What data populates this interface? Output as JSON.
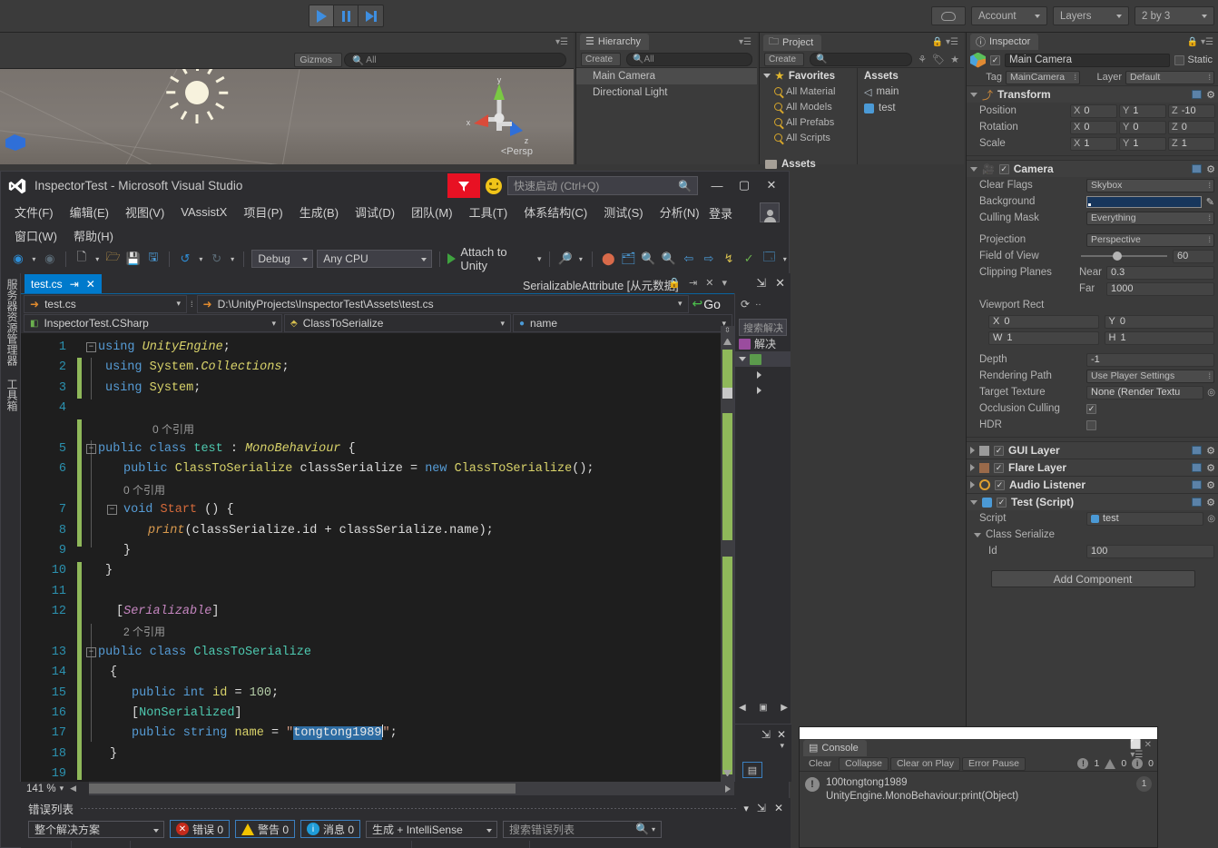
{
  "unity": {
    "toolbar": {
      "play": "play-icon",
      "pause": "pause-icon",
      "step": "step-icon",
      "cloud": "cloud-icon",
      "account": "Account",
      "layers": "Layers",
      "layout": "2 by 3"
    },
    "scene": {
      "gizmos": "Gizmos",
      "search_placeholder": "All",
      "persp": "Persp",
      "axis_x": "x",
      "axis_y": "y",
      "axis_z": "z"
    },
    "hierarchy": {
      "tab": "Hierarchy",
      "create": "Create",
      "search_placeholder": "All",
      "items": [
        {
          "label": "Main Camera",
          "selected": true
        },
        {
          "label": "Directional Light",
          "selected": false
        }
      ]
    },
    "project": {
      "tab": "Project",
      "create": "Create",
      "search_placeholder": "",
      "favorites_header": "Favorites",
      "favorites": [
        "All Material",
        "All Models",
        "All Prefabs",
        "All Scripts"
      ],
      "assets_root": "Assets",
      "assets_header": "Assets",
      "assets": [
        {
          "label": "main",
          "icon": "scene-icon"
        },
        {
          "label": "test",
          "icon": "cs-script-icon"
        }
      ]
    },
    "inspector": {
      "tab": "Inspector",
      "object_name": "Main Camera",
      "object_enabled": true,
      "static_label": "Static",
      "tag_label": "Tag",
      "tag_value": "MainCamera",
      "layer_label": "Layer",
      "layer_value": "Default",
      "components": [
        {
          "title": "Transform",
          "enabled": null,
          "rows": [
            {
              "label": "Position",
              "x": "0",
              "y": "1",
              "z": "-10"
            },
            {
              "label": "Rotation",
              "x": "0",
              "y": "0",
              "z": "0"
            },
            {
              "label": "Scale",
              "x": "1",
              "y": "1",
              "z": "1"
            }
          ]
        }
      ],
      "camera": {
        "title": "Camera",
        "enabled": true,
        "clear_flags_label": "Clear Flags",
        "clear_flags_value": "Skybox",
        "background_label": "Background",
        "background_color": "#17365c",
        "culling_label": "Culling Mask",
        "culling_value": "Everything",
        "projection_label": "Projection",
        "projection_value": "Perspective",
        "fov_label": "Field of View",
        "fov_value": "60",
        "clipping_label": "Clipping Planes",
        "near_label": "Near",
        "near_value": "0.3",
        "far_label": "Far",
        "far_value": "1000",
        "viewport_label": "Viewport Rect",
        "vp_x_label": "X",
        "vp_x": "0",
        "vp_y_label": "Y",
        "vp_y": "0",
        "vp_w_label": "W",
        "vp_w": "1",
        "vp_h_label": "H",
        "vp_h": "1",
        "depth_label": "Depth",
        "depth_value": "-1",
        "rendering_label": "Rendering Path",
        "rendering_value": "Use Player Settings",
        "target_label": "Target Texture",
        "target_value": "None (Render Textu",
        "occlusion_label": "Occlusion Culling",
        "occlusion_checked": true,
        "hdr_label": "HDR",
        "hdr_checked": false
      },
      "layers_list": [
        {
          "title": "GUI Layer",
          "enabled": true
        },
        {
          "title": "Flare Layer",
          "enabled": true
        },
        {
          "title": "Audio Listener",
          "enabled": true
        }
      ],
      "script_component": {
        "title": "Test (Script)",
        "enabled": true,
        "script_label": "Script",
        "script_value": "test",
        "class_label": "Class Serialize",
        "id_label": "Id",
        "id_value": "100"
      },
      "add_component": "Add Component"
    },
    "console": {
      "tab": "Console",
      "buttons": [
        "Clear",
        "Collapse",
        "Clear on Play",
        "Error Pause"
      ],
      "counts": {
        "errors": "1",
        "warnings": "0",
        "infos": "0"
      },
      "entry_line1": "100tongtong1989",
      "entry_line2": "UnityEngine.MonoBehaviour:print(Object)",
      "entry_badge": "1"
    }
  },
  "vs": {
    "title": "InspectorTest - Microsoft Visual Studio",
    "quick_launch_placeholder": "快速启动 (Ctrl+Q)",
    "menus_row1": [
      "文件(F)",
      "编辑(E)",
      "视图(V)",
      "VAssistX",
      "项目(P)",
      "生成(B)",
      "调试(D)",
      "团队(M)",
      "工具(T)",
      "体系结构(C)",
      "测试(S)",
      "分析(N)"
    ],
    "menus_row2": [
      "窗口(W)",
      "帮助(H)"
    ],
    "login": "登录",
    "window_controls": {
      "minimize": "minimize-icon",
      "maximize": "maximize-icon",
      "close": "close-icon"
    },
    "toolbar": {
      "config": "Debug",
      "platform": "Any CPU",
      "attach": "Attach to Unity"
    },
    "left_strip": [
      "服务器资源管理器",
      "工具箱"
    ],
    "document_tab": "test.cs",
    "provider_title": "SerializableAttribute [从元数据]",
    "nav": {
      "file_combo": "test.cs",
      "path_combo": "D:\\UnityProjects\\InspectorTest\\Assets\\test.cs",
      "go_label": "Go",
      "type_combo": "InspectorTest.CSharp",
      "class_combo": "ClassToSerialize",
      "member_combo": "name"
    },
    "zoom": "141 %",
    "code": {
      "selected_text": "tongtong1989",
      "lines": [
        {
          "n": "1",
          "indent": 0,
          "text": "using UnityEngine;"
        },
        {
          "n": "2",
          "indent": 0,
          "text": "using System.Collections;"
        },
        {
          "n": "3",
          "indent": 0,
          "text": "using System;"
        },
        {
          "n": "4",
          "indent": 0,
          "text": ""
        },
        {
          "n": "",
          "indent": 0,
          "text": "0 个引用",
          "codelens": true
        },
        {
          "n": "5",
          "indent": 0,
          "text": "public class test : MonoBehaviour {"
        },
        {
          "n": "6",
          "indent": 1,
          "text": "public ClassToSerialize classSerialize = new ClassToSerialize();"
        },
        {
          "n": "",
          "indent": 1,
          "text": "0 个引用",
          "codelens": true
        },
        {
          "n": "7",
          "indent": 1,
          "text": "void Start () {"
        },
        {
          "n": "8",
          "indent": 2,
          "text": "print(classSerialize.id + classSerialize.name);"
        },
        {
          "n": "9",
          "indent": 1,
          "text": "}"
        },
        {
          "n": "10",
          "indent": 0,
          "text": "}"
        },
        {
          "n": "11",
          "indent": 0,
          "text": ""
        },
        {
          "n": "12",
          "indent": 0,
          "text": "[Serializable]"
        },
        {
          "n": "",
          "indent": 0,
          "text": "2 个引用",
          "codelens": true
        },
        {
          "n": "13",
          "indent": 0,
          "text": "public class ClassToSerialize"
        },
        {
          "n": "14",
          "indent": 0,
          "text": "{"
        },
        {
          "n": "15",
          "indent": 1,
          "text": "public int id = 100;"
        },
        {
          "n": "16",
          "indent": 1,
          "text": "[NonSerialized]"
        },
        {
          "n": "17",
          "indent": 1,
          "text": "public string name = \"tongtong1989\";"
        },
        {
          "n": "18",
          "indent": 0,
          "text": "}"
        },
        {
          "n": "19",
          "indent": 0,
          "text": ""
        }
      ]
    },
    "solution_explorer": {
      "search_placeholder": "搜索解决",
      "solution_label": "解决",
      "project_label": ""
    },
    "error_list": {
      "title": "错误列表",
      "scope": "整个解决方案",
      "errors_label": "错误 0",
      "warnings_label": "警告 0",
      "messages_label": "消息 0",
      "build_filter": "生成 + IntelliSense",
      "search_placeholder": "搜索错误列表"
    }
  }
}
